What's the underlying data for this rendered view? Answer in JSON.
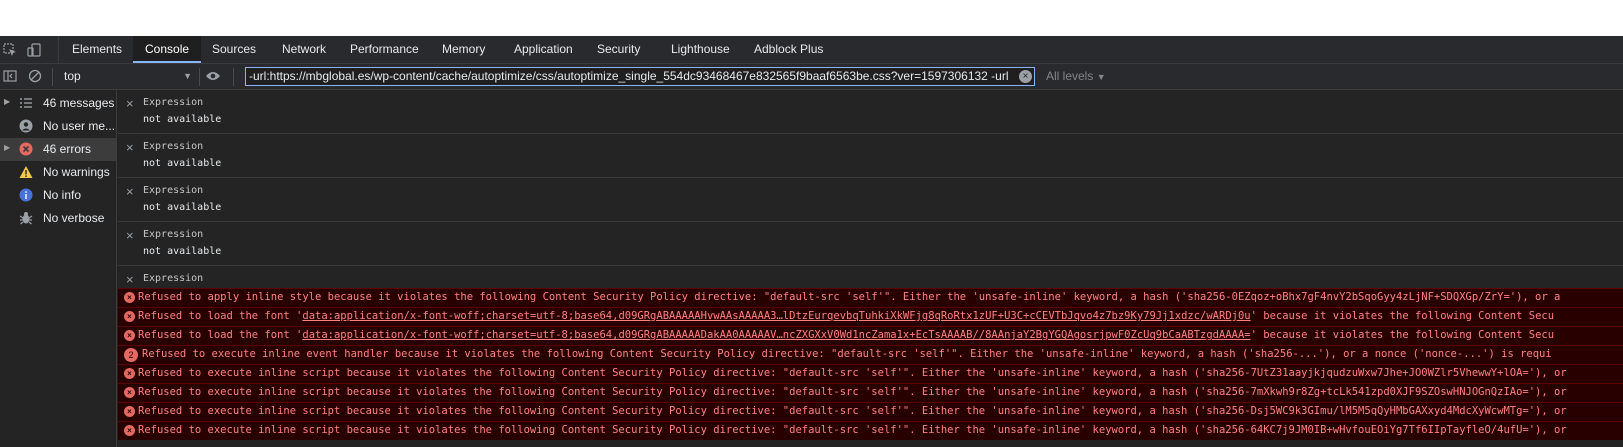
{
  "tabs": [
    "Elements",
    "Console",
    "Sources",
    "Network",
    "Performance",
    "Memory",
    "Application",
    "Security",
    "Lighthouse",
    "Adblock Plus"
  ],
  "active_tab": "Console",
  "toolbar": {
    "context": "top",
    "filter_value": "-url:https://mbglobal.es/wp-content/cache/autoptimize/css/autoptimize_single_554dc93468467e832565f9baaf6563be.css?ver=1597306132 -url",
    "levels": "All levels"
  },
  "sidebar": {
    "items": [
      {
        "label": "46 messages",
        "icon": "list-icon"
      },
      {
        "label": "No user me...",
        "icon": "user-icon"
      },
      {
        "label": "46 errors",
        "icon": "error-icon"
      },
      {
        "label": "No warnings",
        "icon": "warning-icon"
      },
      {
        "label": "No info",
        "icon": "info-icon"
      },
      {
        "label": "No verbose",
        "icon": "bug-icon"
      }
    ]
  },
  "expressions": [
    {
      "label": "Expression",
      "value": "not available"
    },
    {
      "label": "Expression",
      "value": "not available"
    },
    {
      "label": "Expression",
      "value": "not available"
    },
    {
      "label": "Expression",
      "value": "not available"
    },
    {
      "label": "Expression",
      "value": ""
    }
  ],
  "errors": [
    {
      "text": "Refused to apply inline style because it violates the following Content Security Policy directive: \"default-src 'self'\". Either the 'unsafe-inline' keyword, a hash ('sha256-0EZqoz+oBhx7gF4nvY2bSqoGyy4zLjNF+SDQXGp/ZrY='), or a"
    },
    {
      "pre": "Refused to load the font '",
      "link": "data:application/x-font-woff;charset=utf-8;base64,d09GRgABAAAAAHvwAAsAAAAA3…lDtzEurqevbqTuhkiXkWFjg8qRoRtx1zUF+U3C+cCEVTbJqvo4z7bz9Ky79Jj1xdzc/wARDj0u",
      "post": "' because it violates the following Content Secu"
    },
    {
      "pre": "Refused to load the font '",
      "link": "data:application/x-font-woff;charset=utf-8;base64,d09GRgABAAAAADakAA0AAAAAV…ncZXGXxV0Wd1ncZama1x+EcTsAAAAB//8AAnjaY2BgYGQAgosrjpwF0ZcUq9bCaABTzgdAAAA=",
      "post": "' because it violates the following Content Secu"
    },
    {
      "badge": "2",
      "text": "Refused to execute inline event handler because it violates the following Content Security Policy directive: \"default-src 'self'\". Either the 'unsafe-inline' keyword, a hash ('sha256-...'), or a nonce ('nonce-...') is requi"
    },
    {
      "text": "Refused to execute inline script because it violates the following Content Security Policy directive: \"default-src 'self'\". Either the 'unsafe-inline' keyword, a hash ('sha256-7UtZ31aayjkjqudzuWxw7Jhe+JO0WZlr5VhewwY+lOA='), or"
    },
    {
      "text": "Refused to execute inline script because it violates the following Content Security Policy directive: \"default-src 'self'\". Either the 'unsafe-inline' keyword, a hash ('sha256-7mXkwh9r8Zg+tcLk541zpd0XJF9SZOswHNJOGnQzIAo='), or"
    },
    {
      "text": "Refused to execute inline script because it violates the following Content Security Policy directive: \"default-src 'self'\". Either the 'unsafe-inline' keyword, a hash ('sha256-Dsj5WC9k3GImu/lM5M5qQyHMbGAXxyd4MdcXyWcwMTg='), or"
    },
    {
      "text": "Refused to execute inline script because it violates the following Content Security Policy directive: \"default-src 'self'\". Either the 'unsafe-inline' keyword, a hash ('sha256-64KC7j9JM0IB+wHvfouEOiYg7Tf6IIpTayfleO/4ufU='), or"
    }
  ],
  "colors": {
    "error_text": "#ff8080",
    "error_bg": "#290000",
    "accent": "#8ab4f8"
  }
}
